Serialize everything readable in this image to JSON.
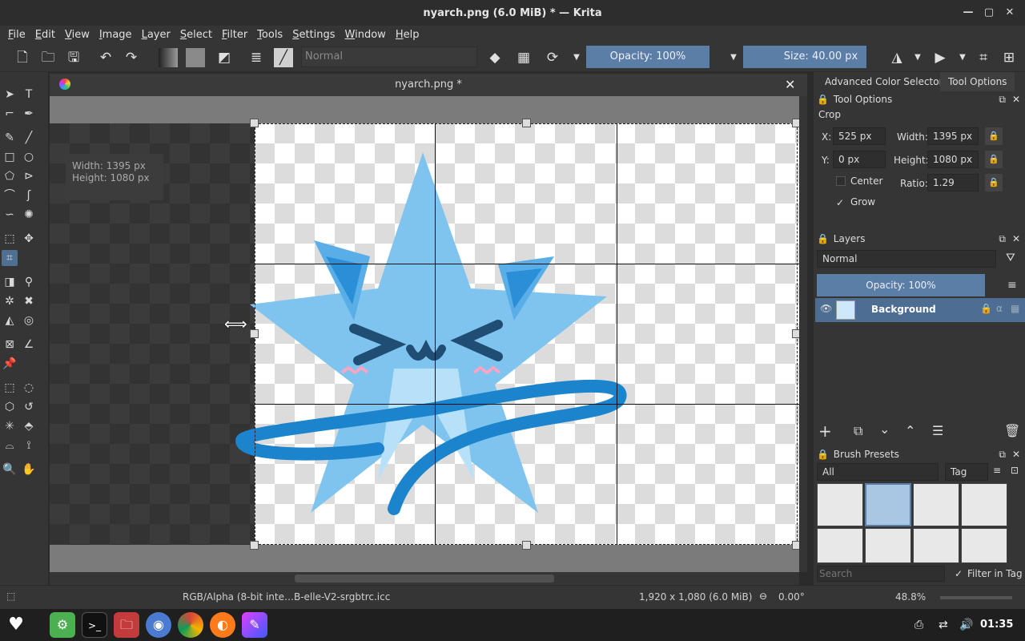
{
  "window": {
    "title": "nyarch.png (6.0 MiB)  * — Krita"
  },
  "menubar": [
    "File",
    "Edit",
    "View",
    "Image",
    "Layer",
    "Select",
    "Filter",
    "Tools",
    "Settings",
    "Window",
    "Help"
  ],
  "toolbar": {
    "blend_mode": "Normal",
    "opacity_label": "Opacity: 100%",
    "size_label": "Size: 40.00 px",
    "opacity_value": 1.0
  },
  "document": {
    "tab_title": "nyarch.png *",
    "crop_info_width": "Width: 1395 px",
    "crop_info_height": "Height: 1080 px"
  },
  "right_panel": {
    "tabs": [
      "Advanced Color Selector",
      "Tool Options"
    ],
    "tool_options": {
      "header": "Tool Options",
      "section": "Crop",
      "x_label": "X:",
      "x_value": "525 px",
      "y_label": "Y:",
      "y_value": "0 px",
      "width_label": "Width:",
      "width_value": "1395 px",
      "height_label": "Height:",
      "height_value": "1080 px",
      "center_label": "Center",
      "ratio_label": "Ratio:",
      "ratio_value": "1.29",
      "grow_label": "Grow",
      "center_checked": false,
      "grow_checked": true
    },
    "layers": {
      "header": "Layers",
      "blend_mode": "Normal",
      "opacity_label": "Opacity:  100%",
      "layer_name": "Background"
    },
    "brush_presets": {
      "header": "Brush Presets",
      "filter": "All",
      "tag_label": "Tag",
      "search_placeholder": "Search",
      "filter_in_tag": "Filter in Tag"
    }
  },
  "statusbar": {
    "color_profile": "RGB/Alpha (8-bit inte…B-elle-V2-srgbtrc.icc",
    "image_size": "1,920 x 1,080 (6.0 MiB)",
    "rotation": "0.00°",
    "zoom": "48.8%"
  },
  "taskbar": {
    "clock": "01:35"
  },
  "colors": {
    "accent": "#5a7ea6",
    "layer_selected": "#4d6d92",
    "mascot_light": "#7ec4ef",
    "mascot_dark": "#2a8fd6"
  }
}
